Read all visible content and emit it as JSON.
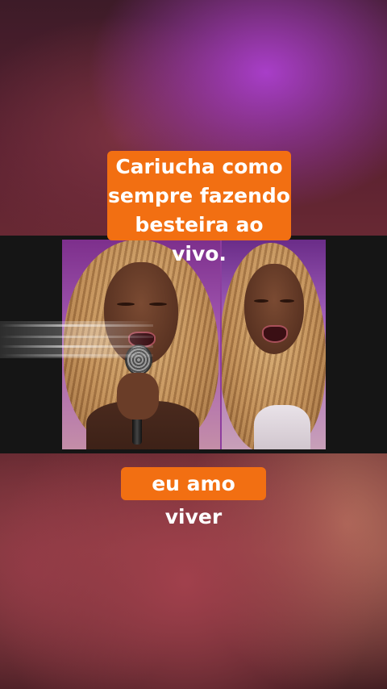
{
  "captions": {
    "top": "Cariucha como\nsempre fazendo\nbesteira ao vivo.",
    "bottom": "eu amo viver"
  },
  "colors": {
    "caption_background": "#f26f12",
    "caption_text": "#ffffff",
    "video_band": "#151515",
    "backdrop_purple": "#a83ec8"
  },
  "scene": {
    "left_panel": "woman with long curly blonde hair singing into a microphone",
    "right_panel": "same woman singing, close-up"
  }
}
